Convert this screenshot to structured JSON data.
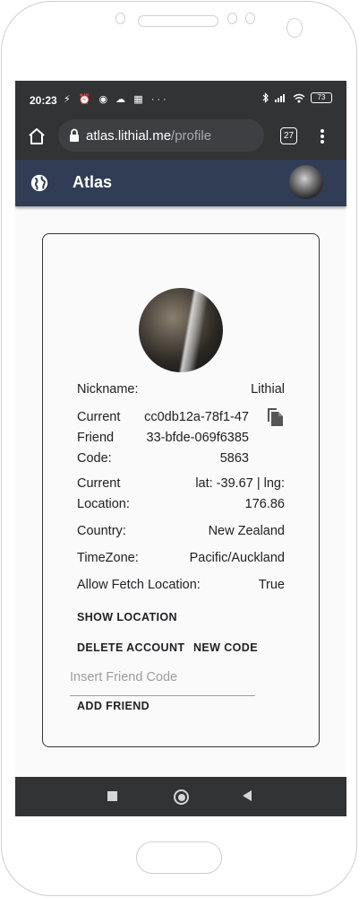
{
  "status_bar": {
    "time": "20:23",
    "left_icons": "⚡ ⏰ ◉ ☁ ▦ ···",
    "battery": "73",
    "right_icons": [
      "bluetooth-icon",
      "signal-icon",
      "wifi-icon",
      "battery-icon"
    ]
  },
  "browser": {
    "url_domain": "atlas.lithial.me",
    "url_path": "/profile",
    "tab_count": "27"
  },
  "app_bar": {
    "title": "Atlas",
    "background_color": "#313d55"
  },
  "profile": {
    "nickname_label": "Nickname:",
    "nickname_value": "Lithial",
    "friend_code_label": "Current Friend Code:",
    "friend_code_value": "cc0db12a-78f1-4733-bfde-069f63855863",
    "location_label": "Current Location:",
    "location_value": "lat: -39.67 | lng: 176.86",
    "country_label": "Country:",
    "country_value": "New Zealand",
    "timezone_label": "TimeZone:",
    "timezone_value": "Pacific/Auckland",
    "fetch_label": "Allow Fetch Location:",
    "fetch_value": "True"
  },
  "actions": {
    "show_location": "SHOW LOCATION",
    "delete_account": "DELETE ACCOUNT",
    "new_code": "NEW CODE",
    "friend_code_placeholder": "Insert Friend Code",
    "add_friend": "ADD FRIEND"
  },
  "nav_bar": {
    "buttons": [
      "recents-button",
      "home-button",
      "back-button"
    ]
  }
}
